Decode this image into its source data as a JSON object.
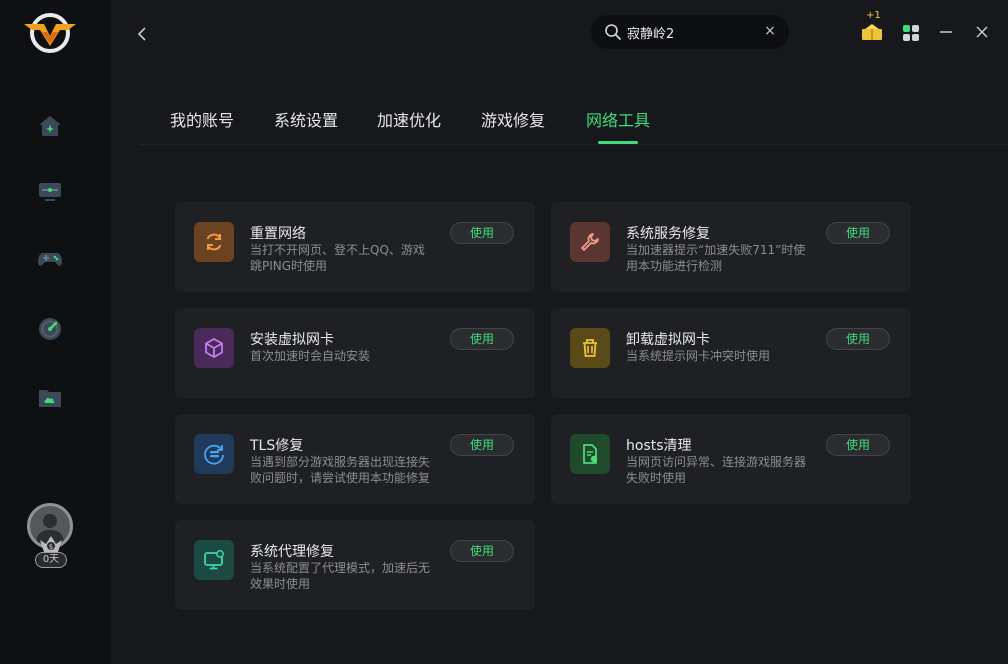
{
  "header": {
    "search": {
      "value": "寂静岭2",
      "clear_glyph": "×"
    },
    "reward_badge": "+1"
  },
  "sidebar": {
    "items": [
      {
        "name": "home"
      },
      {
        "name": "speed-boost"
      },
      {
        "name": "games"
      },
      {
        "name": "network-test"
      },
      {
        "name": "folder"
      }
    ],
    "user": {
      "days": "0天"
    }
  },
  "tabs": [
    {
      "label": "我的账号"
    },
    {
      "label": "系统设置"
    },
    {
      "label": "加速优化"
    },
    {
      "label": "游戏修复"
    },
    {
      "label": "网络工具",
      "active": true
    }
  ],
  "tools": [
    {
      "title": "重置网络",
      "desc": "当打不开网页、登不上QQ、游戏跳PING时使用",
      "button": "使用",
      "icon": "refresh-icon",
      "color": "#6b4322",
      "accent": "#f39a3c"
    },
    {
      "title": "系统服务修复",
      "desc": "当加速器提示“加速失败711”时使用本功能进行检测",
      "button": "使用",
      "icon": "wrench-icon",
      "color": "#5a3532",
      "accent": "#f19a8c"
    },
    {
      "title": "安装虚拟网卡",
      "desc": "首次加速时会自动安装",
      "button": "使用",
      "icon": "cube-icon",
      "color": "#4a2a5a",
      "accent": "#c77df0"
    },
    {
      "title": "卸载虚拟网卡",
      "desc": "当系统提示网卡冲突时使用",
      "button": "使用",
      "icon": "trash-icon",
      "color": "#5a4a18",
      "accent": "#f0c43a"
    },
    {
      "title": "TLS修复",
      "desc": "当遇到部分游戏服务器出现连接失败问题时，请尝试使用本功能修复",
      "button": "使用",
      "icon": "tls-icon",
      "color": "#1f3a5a",
      "accent": "#4ea3f2"
    },
    {
      "title": "hosts清理",
      "desc": "当网页访问异常、连接游戏服务器失败时使用",
      "button": "使用",
      "icon": "document-icon",
      "color": "#1f4a2c",
      "accent": "#4ed97a"
    },
    {
      "title": "系统代理修复",
      "desc": "当系统配置了代理模式，加速后无效果时使用",
      "button": "使用",
      "icon": "monitor-icon",
      "color": "#1a4a40",
      "accent": "#3ed6b0"
    }
  ]
}
